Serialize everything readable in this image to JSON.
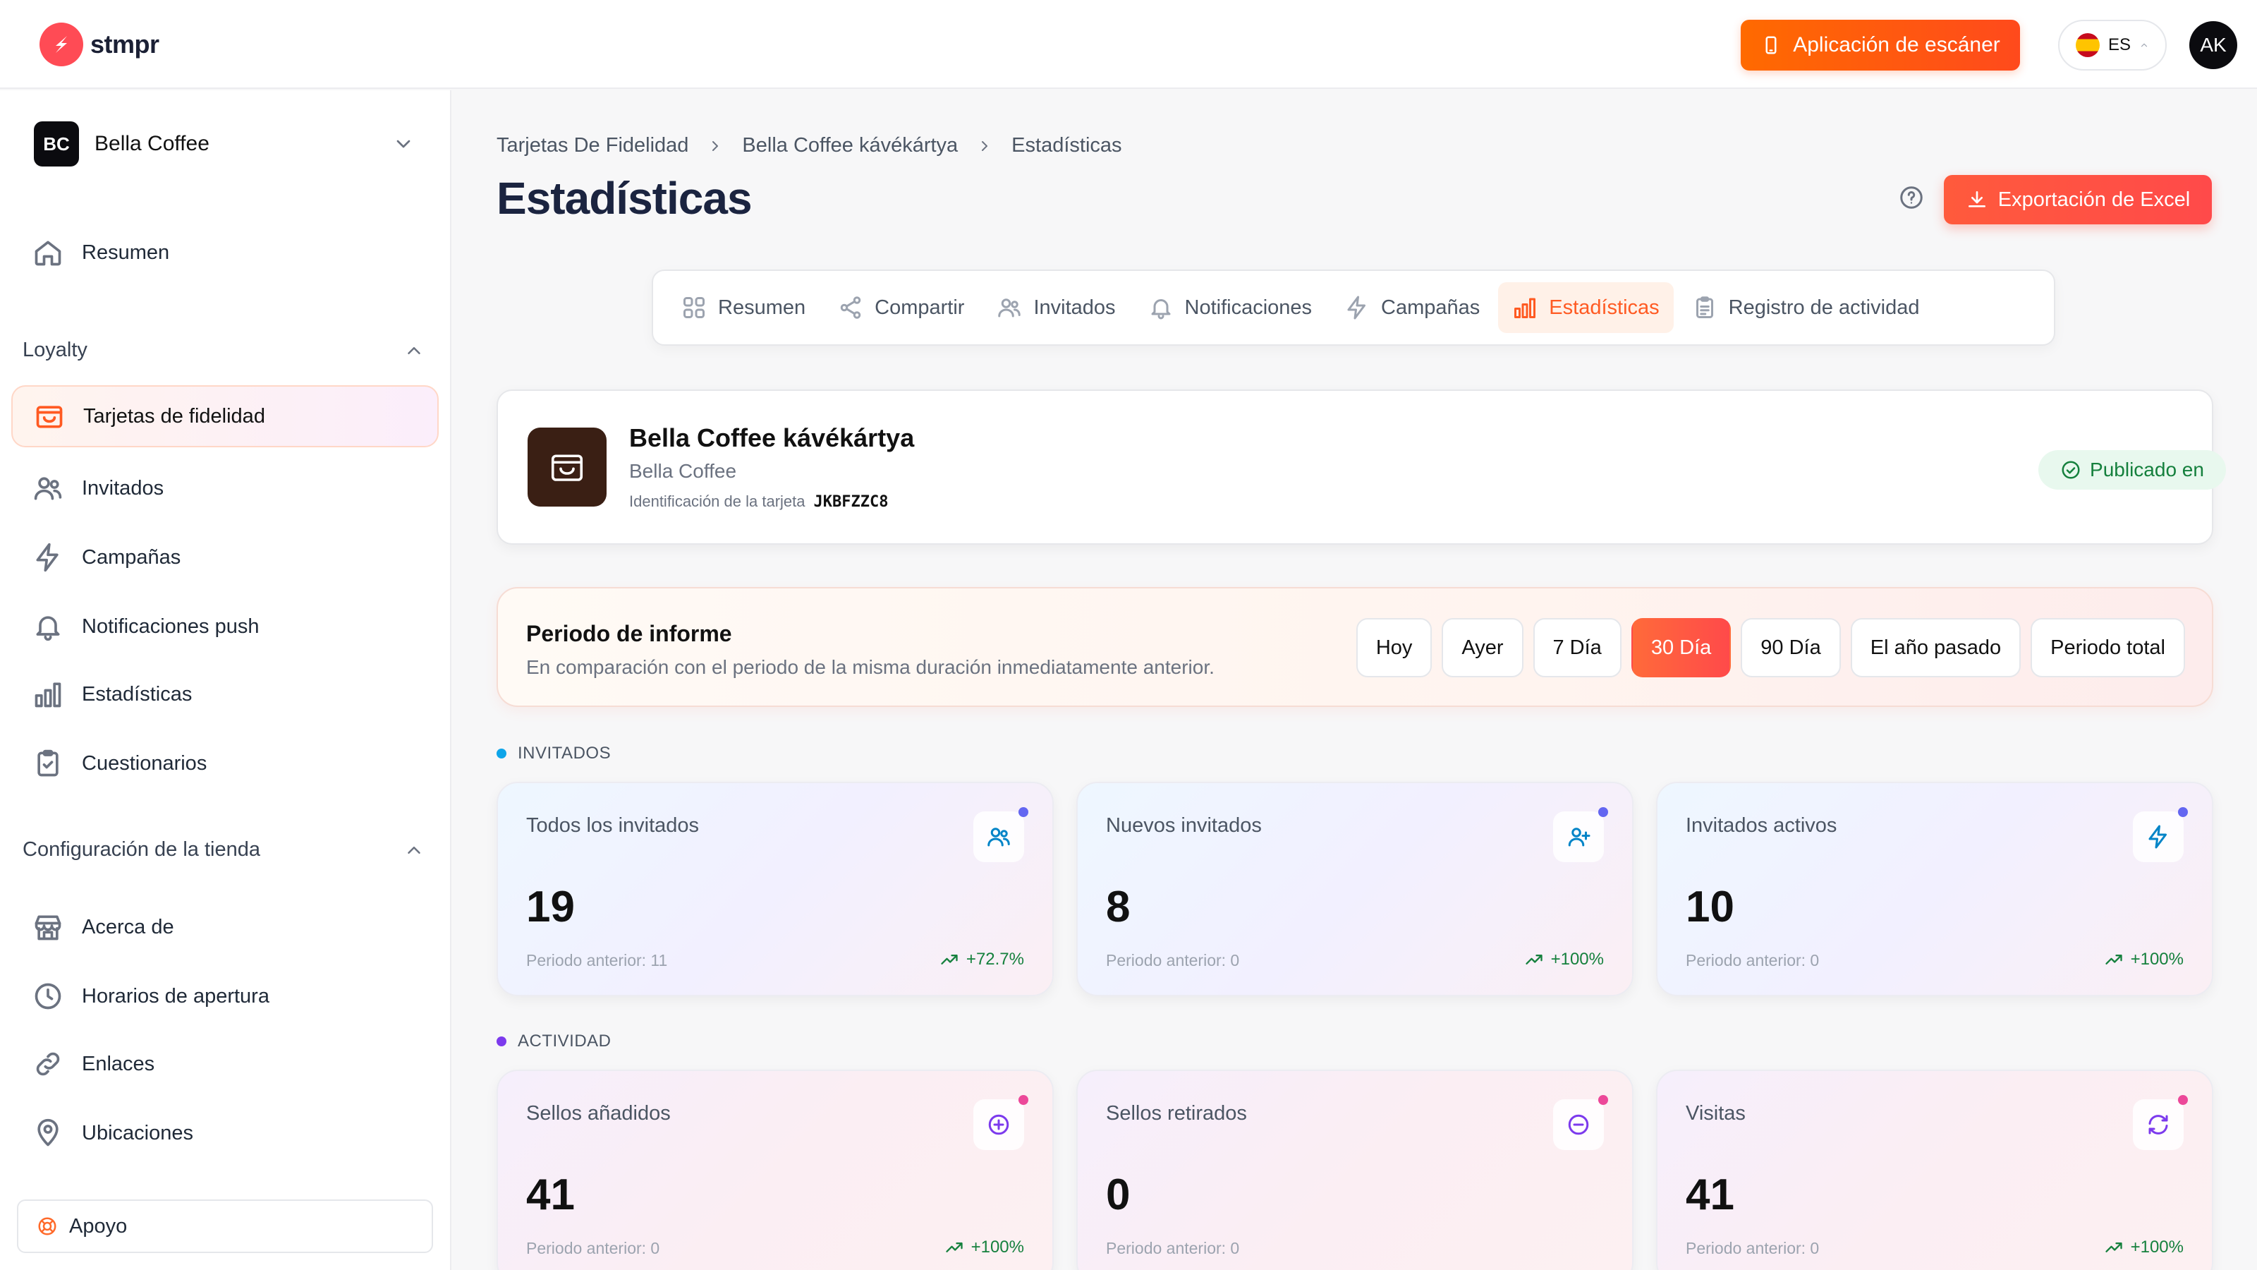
{
  "brand": {
    "name": "stmpr"
  },
  "header": {
    "scanner_label": "Aplicación de escáner",
    "language_code": "ES",
    "user_initials": "AK"
  },
  "sidebar": {
    "store": {
      "initials": "BC",
      "name": "Bella Coffee"
    },
    "overview_label": "Resumen",
    "loyalty_section": "Loyalty",
    "loyalty_items": [
      {
        "label": "Tarjetas de fidelidad",
        "icon": "wallet-icon",
        "active": true
      },
      {
        "label": "Invitados",
        "icon": "users-icon"
      },
      {
        "label": "Campañas",
        "icon": "bolt-icon"
      },
      {
        "label": "Notificaciones push",
        "icon": "bell-icon"
      },
      {
        "label": "Estadísticas",
        "icon": "bar-chart-icon"
      },
      {
        "label": "Cuestionarios",
        "icon": "clipboard-icon"
      }
    ],
    "store_section": "Configuración de la tienda",
    "store_items": [
      {
        "label": "Acerca de",
        "icon": "store-icon"
      },
      {
        "label": "Horarios de apertura",
        "icon": "clock-icon"
      },
      {
        "label": "Enlaces",
        "icon": "link-icon"
      },
      {
        "label": "Ubicaciones",
        "icon": "map-pin-icon"
      }
    ],
    "support_label": "Apoyo"
  },
  "breadcrumb": [
    "Tarjetas De Fidelidad",
    "Bella Coffee kávékártya",
    "Estadísticas"
  ],
  "page_title": "Estadísticas",
  "export_label": "Exportación de Excel",
  "tabs": [
    {
      "label": "Resumen",
      "icon": "grid-icon"
    },
    {
      "label": "Compartir",
      "icon": "share-icon"
    },
    {
      "label": "Invitados",
      "icon": "users-icon"
    },
    {
      "label": "Notificaciones",
      "icon": "bell-icon"
    },
    {
      "label": "Campañas",
      "icon": "bolt-icon"
    },
    {
      "label": "Estadísticas",
      "icon": "bar-chart-icon",
      "active": true
    },
    {
      "label": "Registro de actividad",
      "icon": "clipboard-icon"
    }
  ],
  "card": {
    "name": "Bella Coffee kávékártya",
    "store": "Bella Coffee",
    "id_label": "Identificación de la tarjeta",
    "id": "JKBFZZC8",
    "status": "Publicado en"
  },
  "period": {
    "title": "Periodo de informe",
    "description": "En comparación con el periodo de la misma duración inmediatamente anterior.",
    "options": [
      "Hoy",
      "Ayer",
      "7 Día",
      "30 Día",
      "90 Día",
      "El año pasado",
      "Periodo total"
    ],
    "selected": "30 Día"
  },
  "sections": {
    "guests": "INVITADOS",
    "activity": "ACTIVIDAD"
  },
  "guest_stats": [
    {
      "label": "Todos los invitados",
      "value": "19",
      "previous": "Periodo anterior: 11",
      "change": "+72.7%",
      "icon": "users-icon"
    },
    {
      "label": "Nuevos invitados",
      "value": "8",
      "previous": "Periodo anterior: 0",
      "change": "+100%",
      "icon": "user-plus-icon"
    },
    {
      "label": "Invitados activos",
      "value": "10",
      "previous": "Periodo anterior: 0",
      "change": "+100%",
      "icon": "bolt-icon"
    }
  ],
  "activity_stats": [
    {
      "label": "Sellos añadidos",
      "value": "41",
      "previous": "Periodo anterior: 0",
      "change": "+100%",
      "icon": "plus-circle-icon"
    },
    {
      "label": "Sellos retirados",
      "value": "0",
      "previous": "Periodo anterior: 0",
      "change": "",
      "icon": "minus-circle-icon"
    },
    {
      "label": "Visitas",
      "value": "41",
      "previous": "Periodo anterior: 0",
      "change": "+100%",
      "icon": "refresh-icon"
    }
  ],
  "colors": {
    "accent": "#ff5a22",
    "guests_dot": "#0ea5e9",
    "activity_dot": "#7c3aed",
    "positive": "#15803d"
  }
}
